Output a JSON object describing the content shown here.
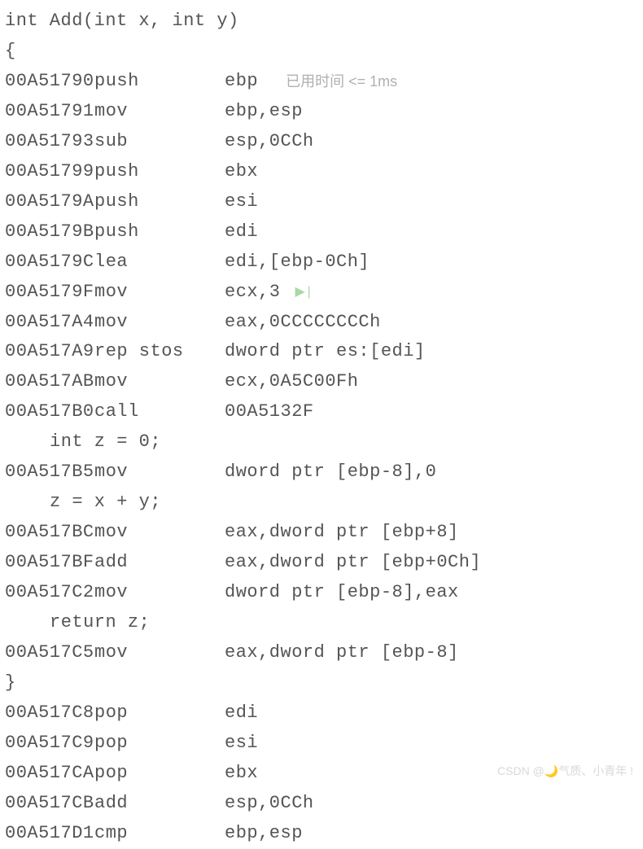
{
  "header": {
    "line1": "int Add(int x, int y)",
    "line2": "{"
  },
  "timing_text": "已用时间 <= 1ms",
  "icon_text": "▶|",
  "asm": [
    {
      "addr": "00A51790",
      "mnem": "push",
      "op": "ebp",
      "timing": true
    },
    {
      "addr": "00A51791",
      "mnem": "mov",
      "op": "ebp,esp"
    },
    {
      "addr": "00A51793",
      "mnem": "sub",
      "op": "esp,0CCh"
    },
    {
      "addr": "00A51799",
      "mnem": "push",
      "op": "ebx"
    },
    {
      "addr": "00A5179A",
      "mnem": "push",
      "op": "esi"
    },
    {
      "addr": "00A5179B",
      "mnem": "push",
      "op": "edi"
    },
    {
      "addr": "00A5179C",
      "mnem": "lea",
      "op": "edi,[ebp-0Ch]"
    },
    {
      "addr": "00A5179F",
      "mnem": "mov",
      "op": "ecx,3",
      "icon": true
    },
    {
      "addr": "00A517A4",
      "mnem": "mov",
      "op": "eax,0CCCCCCCCh"
    },
    {
      "addr": "00A517A9",
      "mnem": "rep stos",
      "op": "dword ptr es:[edi]"
    },
    {
      "addr": "00A517AB",
      "mnem": "mov",
      "op": "ecx,0A5C00Fh"
    },
    {
      "addr": "00A517B0",
      "mnem": "call",
      "op": "00A5132F"
    }
  ],
  "src1": "int z = 0;",
  "asm2": [
    {
      "addr": "00A517B5",
      "mnem": "mov",
      "op": "dword ptr [ebp-8],0"
    }
  ],
  "src2": "z = x + y;",
  "asm3": [
    {
      "addr": "00A517BC",
      "mnem": "mov",
      "op": "eax,dword ptr [ebp+8]"
    },
    {
      "addr": "00A517BF",
      "mnem": "add",
      "op": "eax,dword ptr [ebp+0Ch]"
    },
    {
      "addr": "00A517C2",
      "mnem": "mov",
      "op": "dword ptr [ebp-8],eax"
    }
  ],
  "src3": "return z;",
  "asm4": [
    {
      "addr": "00A517C5",
      "mnem": "mov",
      "op": "eax,dword ptr [ebp-8]"
    }
  ],
  "close_brace": "}",
  "asm5": [
    {
      "addr": "00A517C8",
      "mnem": "pop",
      "op": "edi"
    },
    {
      "addr": "00A517C9",
      "mnem": "pop",
      "op": "esi"
    },
    {
      "addr": "00A517CA",
      "mnem": "pop",
      "op": "ebx"
    },
    {
      "addr": "00A517CB",
      "mnem": "add",
      "op": "esp,0CCh"
    },
    {
      "addr": "00A517D1",
      "mnem": "cmp",
      "op": "ebp,esp"
    }
  ],
  "watermark": "CSDN @🌙气质、小青年 !"
}
